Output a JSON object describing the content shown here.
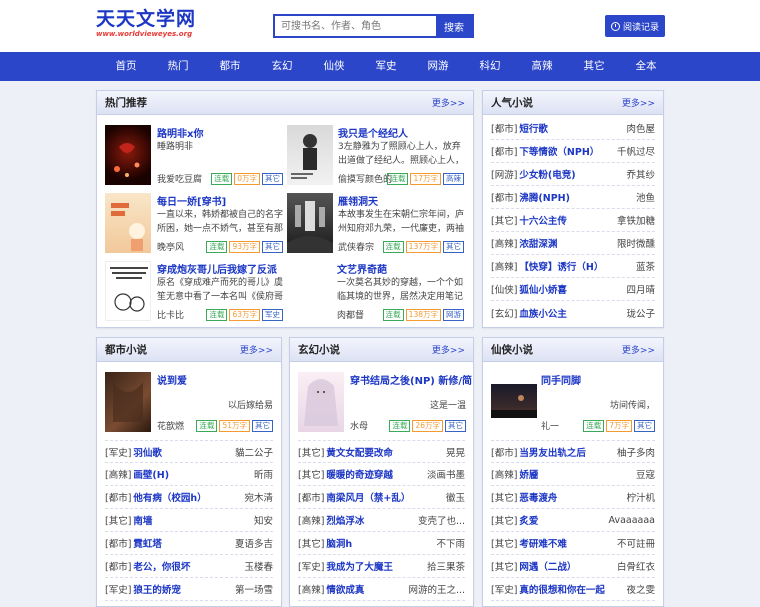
{
  "header": {
    "logo_title": "天天文学网",
    "logo_url": "www.worldvieweyes.org",
    "search_placeholder": "可搜书名、作者、角色",
    "search_button": "搜索",
    "history_button": "阅读记录"
  },
  "nav": [
    "首页",
    "热门",
    "都市",
    "玄幻",
    "仙侠",
    "军史",
    "网游",
    "科幻",
    "高辣",
    "其它",
    "全本"
  ],
  "hot": {
    "title": "热门推荐",
    "more": "更多>>",
    "items": [
      {
        "title": "路明非x你",
        "desc": "睡路明非",
        "author": "我爱吃豆腐",
        "tags": [
          "连载",
          "0万字",
          "其它"
        ]
      },
      {
        "title": "我只是个经纪人",
        "desc": "3左静雅为了照顾心上人，放弃出道做了经纪人。照顾心上人，为了心上人",
        "author": "偷摸写颜色的",
        "tags": [
          "连载",
          "17万字",
          "高辣"
        ]
      },
      {
        "title": "每日一娇[穿书]",
        "desc": "一直以来，韩娇都被自己的名字所困，她一点不娇气，甚至有那么点",
        "author": "晚亭风",
        "tags": [
          "连载",
          "93万字",
          "其它"
        ]
      },
      {
        "title": "雁翎洞天",
        "desc": "本故事发生在宋朝仁宗年间，庐州知府邓九荣，一代廉吏，两袖清风",
        "author": "武侠春宗",
        "tags": [
          "连载",
          "137万字",
          "其它"
        ]
      },
      {
        "title": "穿成炮灰哥儿后我嫁了反派",
        "desc": "原名《穿成难产而死的哥儿》虞笙无意中看了一本名叫《侯府哥",
        "author": "比卡比",
        "tags": [
          "连载",
          "63万字",
          "军史"
        ]
      },
      {
        "title": "文艺界奇葩",
        "desc": "一次莫名其妙的穿越，一个个如临其境的世界，居然决定用笔记下",
        "author": "肉都督",
        "tags": [
          "连载",
          "138万字",
          "网游"
        ]
      }
    ]
  },
  "popular": {
    "title": "人气小说",
    "more": "更多>>",
    "rows": [
      {
        "cat": "[都市]",
        "title": "短行歌",
        "author": "肉色屋"
      },
      {
        "cat": "[都市]",
        "title": "下等情欲（NPH）",
        "author": "千帆过尽"
      },
      {
        "cat": "[网游]",
        "title": "少女粉(电竞)",
        "author": "乔其纱"
      },
      {
        "cat": "[都市]",
        "title": "沸腾(NPH)",
        "author": "池鱼"
      },
      {
        "cat": "[其它]",
        "title": "十六公主传",
        "author": "拿铁加糖"
      },
      {
        "cat": "[高辣]",
        "title": "浓甜深渊",
        "author": "限时微醺"
      },
      {
        "cat": "[高辣]",
        "title": "【快穿】诱行（H）",
        "author": "蓝茶"
      },
      {
        "cat": "[仙侠]",
        "title": "狐仙小娇喜",
        "author": "四月晴"
      },
      {
        "cat": "[玄幻]",
        "title": "血族小公主",
        "author": "珑公子"
      }
    ]
  },
  "urban": {
    "title": "都市小说",
    "more": "更多>>",
    "feature": {
      "title": "说到爱",
      "desc": "以后嫁给易",
      "author": "花歆燃",
      "tags": [
        "连载",
        "51万字",
        "其它"
      ]
    },
    "rows": [
      {
        "cat": "[军史]",
        "title": "羽仙歌",
        "author": "貓二公子"
      },
      {
        "cat": "[高辣]",
        "title": "画壁(H)",
        "author": "昕雨"
      },
      {
        "cat": "[都市]",
        "title": "他有病（校园h）",
        "author": "宛木清"
      },
      {
        "cat": "[其它]",
        "title": "南墙",
        "author": "知安"
      },
      {
        "cat": "[都市]",
        "title": "霓虹塔",
        "author": "夏语多吉"
      },
      {
        "cat": "[都市]",
        "title": "老公，你很坏",
        "author": "玉楼春"
      },
      {
        "cat": "[军史]",
        "title": "狼王的娇宠",
        "author": "第一场雪"
      }
    ]
  },
  "fantasy": {
    "title": "玄幻小说",
    "more": "更多>>",
    "feature": {
      "title": "穿书结局之後(NP) 新修/简",
      "desc": "这是一温",
      "author": "水母",
      "tags": [
        "连载",
        "26万字",
        "其它"
      ]
    },
    "rows": [
      {
        "cat": "[其它]",
        "title": "黄文女配要改命",
        "author": "晃晃"
      },
      {
        "cat": "[其它]",
        "title": "暖暖的奇迹穿越",
        "author": "淡画书墨"
      },
      {
        "cat": "[都市]",
        "title": "南梁风月（禁+乱）",
        "author": "徽玉"
      },
      {
        "cat": "[高辣]",
        "title": "烈焰浮冰",
        "author": "变壳了也..."
      },
      {
        "cat": "[其它]",
        "title": "脑洞h",
        "author": "不下雨"
      },
      {
        "cat": "[军史]",
        "title": "我成为了大魔王",
        "author": "拾三果茶"
      },
      {
        "cat": "[高辣]",
        "title": "情欲成真",
        "author": "网游的王之..."
      }
    ]
  },
  "xianxia": {
    "title": "仙侠小说",
    "more": "更多>>",
    "feature": {
      "title": "同手同脚",
      "desc": "坊间传闻，",
      "author": "礼一",
      "tags": [
        "连载",
        "7万字",
        "其它"
      ]
    },
    "rows": [
      {
        "cat": "[都市]",
        "title": "当男友出轨之后",
        "author": "柚子多肉"
      },
      {
        "cat": "[高辣]",
        "title": "娇靥",
        "author": "豆寇"
      },
      {
        "cat": "[其它]",
        "title": "恶毒渡舟",
        "author": "柠汁机"
      },
      {
        "cat": "[其它]",
        "title": "炙爱",
        "author": "Avaaaaaa"
      },
      {
        "cat": "[其它]",
        "title": "考研难不难",
        "author": "不可註冊"
      },
      {
        "cat": "[其它]",
        "title": "网遇（二战）",
        "author": "白骨红衣"
      },
      {
        "cat": "[军史]",
        "title": "真的很想和你在一起",
        "author": "夜之雯"
      }
    ]
  }
}
